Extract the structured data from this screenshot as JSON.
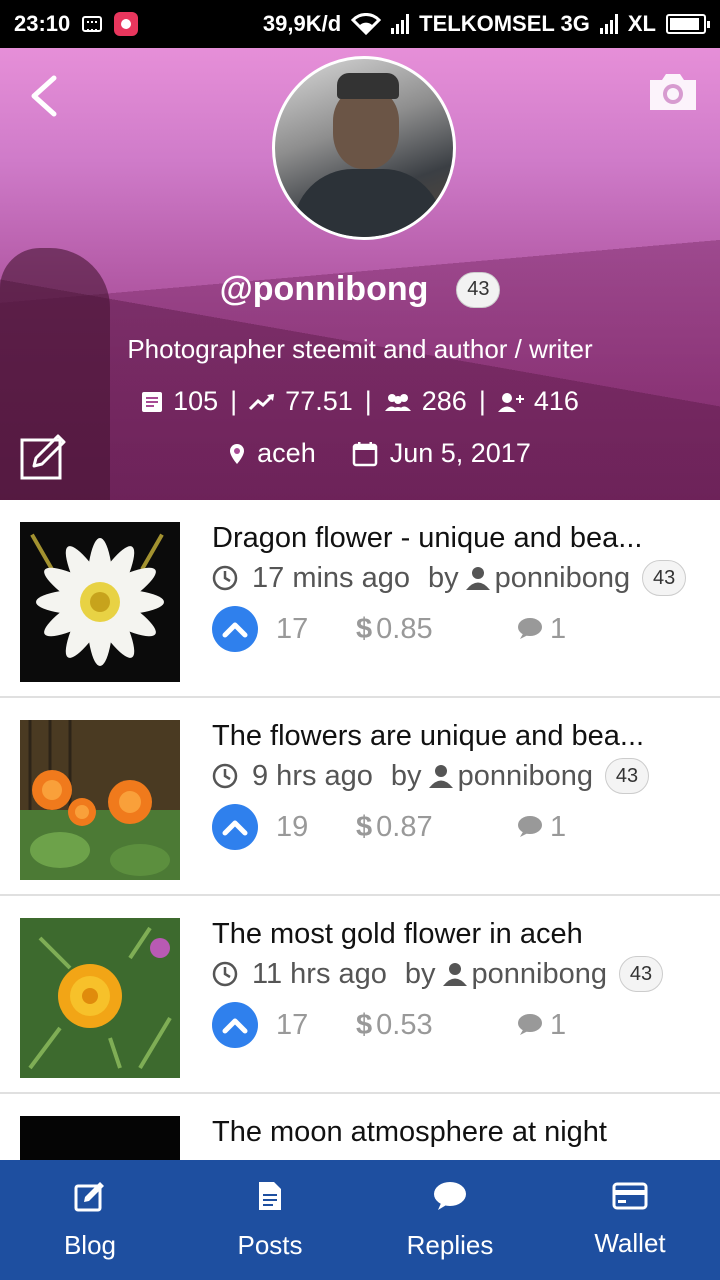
{
  "status_bar": {
    "time": "23:10",
    "speed": "39,9K/d",
    "carrier1": "TELKOMSEL 3G",
    "carrier2": "XL"
  },
  "profile": {
    "username": "@ponnibong",
    "reputation": "43",
    "bio": "Photographer steemit and author / writer",
    "stats": {
      "posts": "105",
      "steem_power": "77.51",
      "followers": "286",
      "following": "416"
    },
    "location": "aceh",
    "joined": "Jun 5, 2017"
  },
  "posts": [
    {
      "title": "Dragon flower - unique and bea...",
      "time": "17 mins ago",
      "by": "by",
      "author": "ponnibong",
      "reputation": "43",
      "votes": "17",
      "payout": "0.85",
      "comments": "1",
      "thumb": "white-flower"
    },
    {
      "title": "The flowers are unique and bea...",
      "time": "9 hrs ago",
      "by": "by",
      "author": "ponnibong",
      "reputation": "43",
      "votes": "19",
      "payout": "0.87",
      "comments": "1",
      "thumb": "orange-flowers"
    },
    {
      "title": "The most gold flower in aceh",
      "time": "11 hrs ago",
      "by": "by",
      "author": "ponnibong",
      "reputation": "43",
      "votes": "17",
      "payout": "0.53",
      "comments": "1",
      "thumb": "gold-flower"
    },
    {
      "title": "The moon atmosphere at night",
      "thumb": "night-sky"
    }
  ],
  "bottom_nav": [
    {
      "label": "Blog",
      "icon": "edit-icon"
    },
    {
      "label": "Posts",
      "icon": "document-icon"
    },
    {
      "label": "Replies",
      "icon": "chat-icon"
    },
    {
      "label": "Wallet",
      "icon": "card-icon"
    }
  ],
  "colors": {
    "nav_bg": "#1e4fa0",
    "vote_blue": "#2f80ed",
    "header_pink": "#cf7bc9"
  }
}
